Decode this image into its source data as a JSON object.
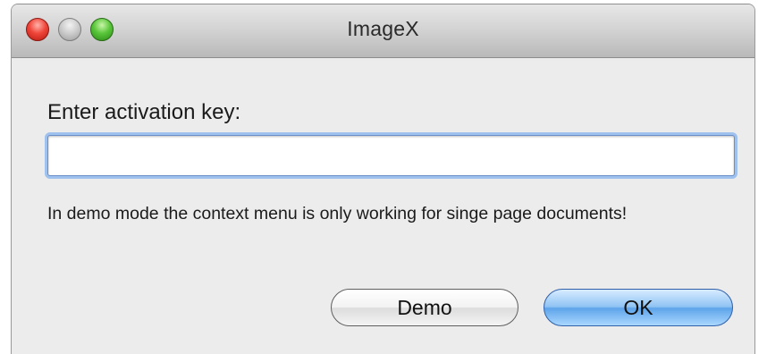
{
  "window": {
    "title": "ImageX"
  },
  "dialog": {
    "prompt": "Enter activation key:",
    "key_input_value": "",
    "note": "In demo mode the context menu is only working for singe page documents!",
    "demo_label": "Demo",
    "ok_label": "OK"
  },
  "icons": [
    "close-button",
    "minimize-button",
    "zoom-button"
  ],
  "colors": {
    "close": "#f0463a",
    "minimize": "#c9c9c9",
    "zoom": "#59c63a",
    "default_button": "#5ea4ea",
    "window_bg": "#ececec"
  }
}
